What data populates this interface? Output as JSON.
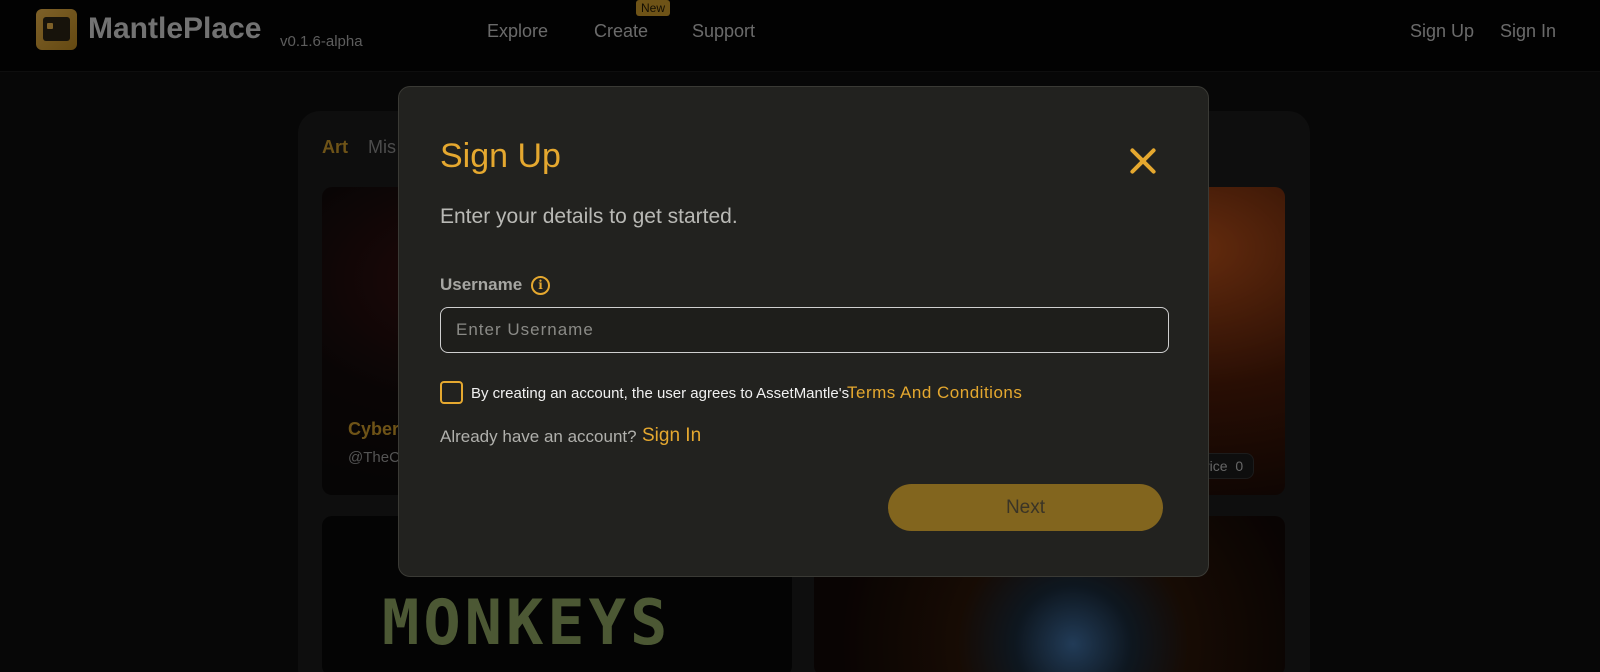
{
  "header": {
    "brand": "MantlePlace",
    "version": "v0.1.6-alpha",
    "nav": {
      "explore": "Explore",
      "create": "Create",
      "create_badge": "New",
      "support": "Support"
    },
    "sign_up": "Sign Up",
    "sign_in": "Sign In"
  },
  "background": {
    "categories": [
      "Art",
      "Mis"
    ],
    "card1": {
      "title": "Cyber",
      "handle": "@TheC"
    },
    "card2": {
      "price_label": "rice",
      "price_value": "0"
    },
    "card3": {
      "image_text": "MONKEYS"
    }
  },
  "modal": {
    "title": "Sign Up",
    "subtitle": "Enter your details to get started.",
    "username_label": "Username",
    "username_placeholder": "Enter Username",
    "username_value": "",
    "terms_text": "By creating an account, the user agrees to AssetMantle's",
    "terms_link": "Terms And Conditions",
    "already_text": "Already have an account?",
    "signin_link": "Sign In",
    "next_label": "Next"
  },
  "colors": {
    "accent": "#e5a82f",
    "button_disabled": "#82651e",
    "modal_bg": "#22221f"
  }
}
